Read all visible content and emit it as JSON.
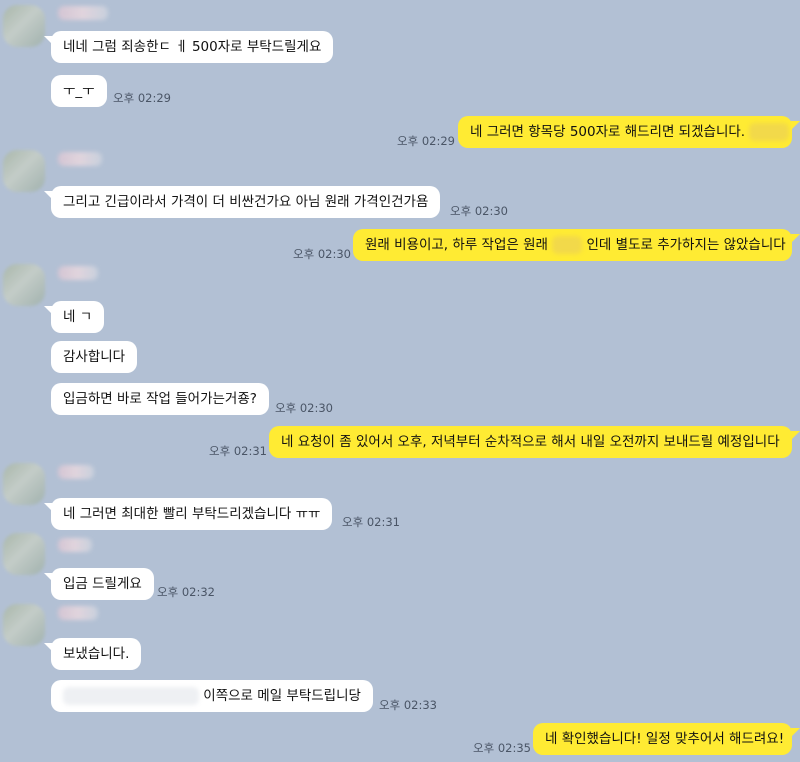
{
  "messages": [
    {
      "side": "left",
      "text": "네네 그럼 죄송한ㄷ ㅔ 500자로 부탁드릴게요",
      "time": ""
    },
    {
      "side": "left",
      "text": "ㅜ_ㅜ",
      "time": "오후 02:29"
    },
    {
      "side": "right",
      "text": "네 그러면 항목당 500자로 해드리면 되겠습니다.",
      "time": "오후 02:29"
    },
    {
      "side": "left",
      "text": "그리고 긴급이라서 가격이 더 비싼건가요 아님 원래 가격인건가욤",
      "time": "오후 02:30"
    },
    {
      "side": "right",
      "text_before": "원래 비용이고, 하루 작업은 원래",
      "text_after": "인데 별도로 추가하지는 않았습니다",
      "time": "오후 02:30"
    },
    {
      "side": "left",
      "text": "네 ㄱ",
      "time": ""
    },
    {
      "side": "left",
      "text": "감사합니다",
      "time": ""
    },
    {
      "side": "left",
      "text": "입금하면 바로 작업 들어가는거죵?",
      "time": "오후 02:30"
    },
    {
      "side": "right",
      "text": "네 요청이 좀 있어서 오후, 저녁부터 순차적으로 해서 내일 오전까지 보내드릴 예정입니다",
      "time": "오후 02:31"
    },
    {
      "side": "left",
      "text": "네 그러면 최대한 빨리 부탁드리겠습니다 ㅠㅠ",
      "time": "오후 02:31"
    },
    {
      "side": "left",
      "text": "입금 드릴게요",
      "time": "오후 02:32"
    },
    {
      "side": "left",
      "text": "보냈습니다.",
      "time": ""
    },
    {
      "side": "left",
      "text": "이쪽으로 메일 부탁드립니당",
      "time": "오후 02:33"
    },
    {
      "side": "right",
      "text": "네 확인했습니다! 일정 맞추어서 해드려요!",
      "time": "오후 02:35"
    }
  ],
  "colors": {
    "background": "#b2c0d4",
    "incoming": "#ffffff",
    "outgoing": "#ffeb33",
    "time": "#4a5566"
  }
}
